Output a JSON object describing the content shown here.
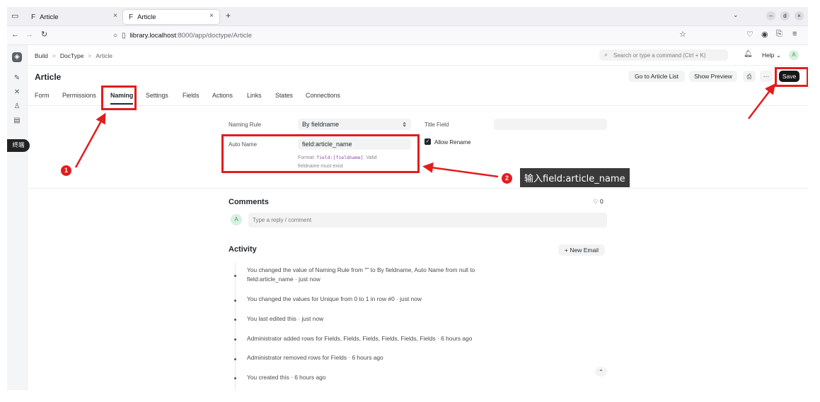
{
  "browser": {
    "tabs": [
      {
        "icon": "F",
        "label": "Article",
        "close": "×"
      },
      {
        "icon": "F",
        "label": "Article",
        "close": "×"
      }
    ],
    "new_tab": "+",
    "url_host": "library.localhost",
    "url_path": ":8000/app/doctype/Article",
    "window_controls": [
      "–",
      "d",
      "×"
    ]
  },
  "app": {
    "breadcrumb": [
      "Build",
      ">",
      "DocType",
      ">",
      "Article"
    ],
    "search_placeholder": "Search or type a command (Ctrl + K)",
    "help_label": "Help",
    "avatar_letter": "A",
    "page_title": "Article",
    "actions": {
      "goto": "Go to Article List",
      "preview": "Show Preview",
      "more": "···",
      "save": "Save"
    },
    "rail_badge": "终端",
    "tabs": [
      "Form",
      "Permissions",
      "Naming",
      "Settings",
      "Fields",
      "Actions",
      "Links",
      "States",
      "Connections"
    ],
    "active_tab": "Naming",
    "naming": {
      "rule_label": "Naming Rule",
      "rule_value": "By fieldname",
      "title_field_label": "Title Field",
      "title_field_value": "",
      "auto_name_label": "Auto Name",
      "auto_name_value": "field:article_name",
      "help_prefix": "Format: ",
      "help_code": "field:[fieldname]",
      "help_suffix": ". Valid",
      "help_line2": "fieldname must exist",
      "allow_rename_label": "Allow Rename",
      "allow_rename_checked": true
    },
    "comments": {
      "title": "Comments",
      "likes": "0",
      "avatar_letter": "A",
      "placeholder": "Type a reply / comment"
    },
    "activity": {
      "title": "Activity",
      "new_email": "+ New Email",
      "items": [
        {
          "line1": "You changed the value of Naming Rule from \"\" to By fieldname, Auto Name from null to",
          "line2": "field:article_name · just now"
        },
        {
          "line1": "You changed the values for Unique from 0 to 1 in row #0 · just now"
        },
        {
          "line1": "You last edited this · just now"
        },
        {
          "line1": "Administrator added rows for Fields, Fields, Fields, Fields, Fields, Fields · 6 hours ago"
        },
        {
          "line1": "Administrator removed rows for Fields · 6 hours ago"
        },
        {
          "line1": "You created this · 6 hours ago"
        }
      ]
    }
  },
  "annotations": {
    "step1": "1",
    "step2": "2",
    "callout_text": "输入field:article_name",
    "color": "#e11d1d"
  }
}
